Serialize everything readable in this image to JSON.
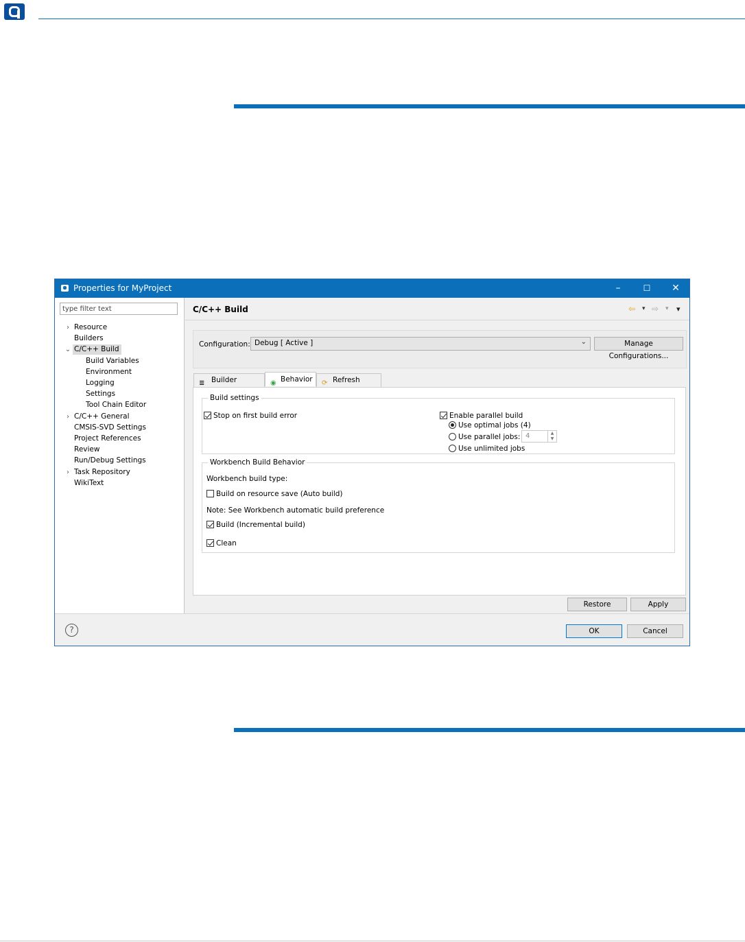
{
  "dialog": {
    "title": "Properties for MyProject",
    "window_controls": {
      "minimize": "–",
      "maximize": "☐",
      "close": "✕"
    }
  },
  "filter": {
    "placeholder": "type filter text"
  },
  "tree": {
    "items": [
      {
        "label": "Resource",
        "expander": "›"
      },
      {
        "label": "Builders"
      },
      {
        "label": "C/C++ Build",
        "expander": "⌄",
        "selected": true
      },
      {
        "label": "Build Variables"
      },
      {
        "label": "Environment"
      },
      {
        "label": "Logging"
      },
      {
        "label": "Settings"
      },
      {
        "label": "Tool Chain Editor"
      },
      {
        "label": "C/C++ General",
        "expander": "›"
      },
      {
        "label": "CMSIS-SVD Settings"
      },
      {
        "label": "Project References"
      },
      {
        "label": "Review"
      },
      {
        "label": "Run/Debug Settings"
      },
      {
        "label": "Task Repository",
        "expander": "›"
      },
      {
        "label": "WikiText"
      }
    ]
  },
  "page": {
    "title": "C/C++ Build",
    "nav": {
      "back": "⇦",
      "forward": "⇨",
      "dropdown": "▾",
      "menu": "▾"
    }
  },
  "configuration": {
    "label": "Configuration:",
    "value": "Debug  [ Active ]",
    "manage_button": "Manage Configurations..."
  },
  "tabs": [
    {
      "label": "Builder Settings",
      "icon": "≣"
    },
    {
      "label": "Behavior",
      "icon": "◉",
      "active": true
    },
    {
      "label": "Refresh Policy",
      "icon": "⟳"
    }
  ],
  "build_settings": {
    "legend": "Build settings",
    "stop_on_first_error": "Stop on first build error",
    "enable_parallel": "Enable parallel build",
    "use_optimal_jobs": "Use optimal jobs (4)",
    "use_parallel_jobs": "Use parallel jobs:",
    "parallel_jobs_value": "4",
    "use_unlimited_jobs": "Use unlimited jobs"
  },
  "workbench": {
    "legend": "Workbench Build Behavior",
    "build_type_label": "Workbench build type:",
    "auto_build": "Build on resource save (Auto build)",
    "note": "Note: See Workbench automatic build preference",
    "incremental_build": "Build (Incremental build)",
    "clean": "Clean"
  },
  "buttons": {
    "restore_defaults": "Restore Defaults",
    "apply": "Apply",
    "ok": "OK",
    "cancel": "Cancel",
    "help": "?"
  },
  "colors": {
    "accent": "#0b6fb9",
    "logo": "#0b4f9c"
  }
}
